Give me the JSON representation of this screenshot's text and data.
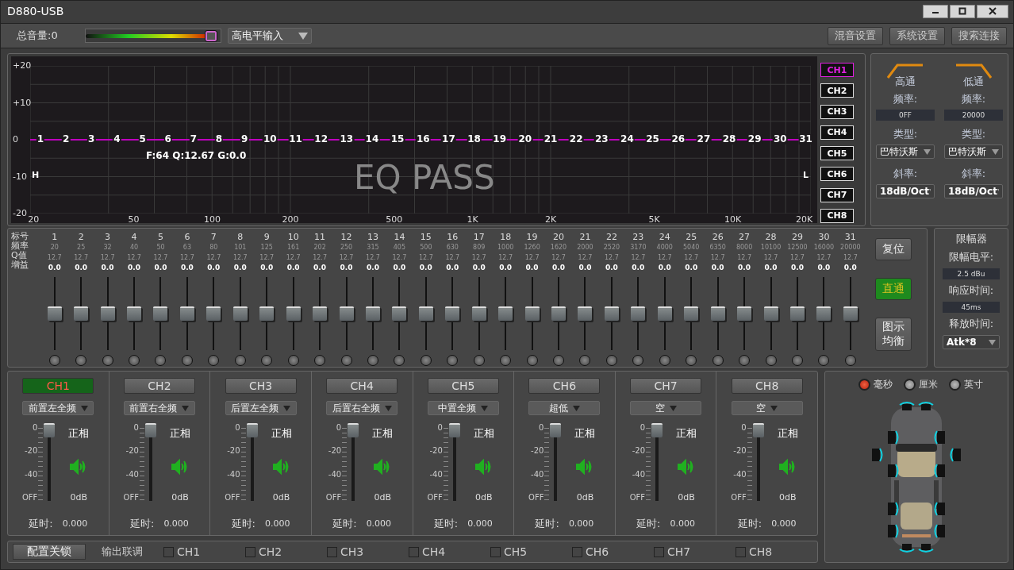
{
  "window": {
    "title": "D880-USB"
  },
  "toolbar": {
    "volume_label": "总音量:0",
    "volume": {
      "level": 1
    },
    "input_select": "高电平输入",
    "buttons": [
      "混音设置",
      "系统设置",
      "搜索连接"
    ]
  },
  "eq_graph": {
    "y_ticks": [
      "+20",
      "+10",
      "0",
      "-10",
      "-20"
    ],
    "x_ticks": [
      "20",
      "50",
      "100",
      "200",
      "500",
      "1K",
      "2K",
      "5K",
      "10K",
      "20K"
    ],
    "band_markers": [
      "1",
      "2",
      "3",
      "4",
      "5",
      "6",
      "7",
      "8",
      "9",
      "10",
      "11",
      "12",
      "13",
      "14",
      "15",
      "16",
      "17",
      "18",
      "19",
      "20",
      "21",
      "22",
      "23",
      "24",
      "25",
      "26",
      "27",
      "28",
      "29",
      "30",
      "31"
    ],
    "readout": "F:64 Q:12.67 G:0.0",
    "status": "EQ PASS",
    "left_mark": "H",
    "right_mark": "L"
  },
  "channel_tabs": [
    {
      "label": "CH1",
      "selected": true
    },
    {
      "label": "CH2",
      "selected": false
    },
    {
      "label": "CH3",
      "selected": false
    },
    {
      "label": "CH4",
      "selected": false
    },
    {
      "label": "CH5",
      "selected": false
    },
    {
      "label": "CH6",
      "selected": false
    },
    {
      "label": "CH7",
      "selected": false
    },
    {
      "label": "CH8",
      "selected": false
    }
  ],
  "filters": [
    {
      "kind": "highpass",
      "title": "高通",
      "freq_label": "频率:",
      "freq": "0FF",
      "type_label": "类型:",
      "type": "巴特沃斯",
      "slope_label": "斜率:",
      "slope": "18dB/Oct"
    },
    {
      "kind": "lowpass",
      "title": "低通",
      "freq_label": "频率:",
      "freq": "20000",
      "type_label": "类型:",
      "type": "巴特沃斯",
      "slope_label": "斜率:",
      "slope": "18dB/Oct"
    }
  ],
  "bands": {
    "row_labels": [
      "标号",
      "频率",
      "Q值",
      "增益"
    ],
    "items": [
      {
        "number": "1",
        "freq": "20",
        "q": "12.7",
        "gain": "0.0",
        "level": 0.5
      },
      {
        "number": "2",
        "freq": "25",
        "q": "12.7",
        "gain": "0.0",
        "level": 0.5
      },
      {
        "number": "3",
        "freq": "32",
        "q": "12.7",
        "gain": "0.0",
        "level": 0.5
      },
      {
        "number": "4",
        "freq": "40",
        "q": "12.7",
        "gain": "0.0",
        "level": 0.5
      },
      {
        "number": "5",
        "freq": "50",
        "q": "12.7",
        "gain": "0.0",
        "level": 0.5
      },
      {
        "number": "6",
        "freq": "63",
        "q": "12.7",
        "gain": "0.0",
        "level": 0.5
      },
      {
        "number": "7",
        "freq": "80",
        "q": "12.7",
        "gain": "0.0",
        "level": 0.5
      },
      {
        "number": "8",
        "freq": "101",
        "q": "12.7",
        "gain": "0.0",
        "level": 0.5
      },
      {
        "number": "9",
        "freq": "125",
        "q": "12.7",
        "gain": "0.0",
        "level": 0.5
      },
      {
        "number": "10",
        "freq": "161",
        "q": "12.7",
        "gain": "0.0",
        "level": 0.5
      },
      {
        "number": "11",
        "freq": "202",
        "q": "12.7",
        "gain": "0.0",
        "level": 0.5
      },
      {
        "number": "12",
        "freq": "250",
        "q": "12.7",
        "gain": "0.0",
        "level": 0.5
      },
      {
        "number": "13",
        "freq": "315",
        "q": "12.7",
        "gain": "0.0",
        "level": 0.5
      },
      {
        "number": "14",
        "freq": "405",
        "q": "12.7",
        "gain": "0.0",
        "level": 0.5
      },
      {
        "number": "15",
        "freq": "500",
        "q": "12.7",
        "gain": "0.0",
        "level": 0.5
      },
      {
        "number": "16",
        "freq": "630",
        "q": "12.7",
        "gain": "0.0",
        "level": 0.5
      },
      {
        "number": "17",
        "freq": "809",
        "q": "12.7",
        "gain": "0.0",
        "level": 0.5
      },
      {
        "number": "18",
        "freq": "1000",
        "q": "12.7",
        "gain": "0.0",
        "level": 0.5
      },
      {
        "number": "19",
        "freq": "1260",
        "q": "12.7",
        "gain": "0.0",
        "level": 0.5
      },
      {
        "number": "20",
        "freq": "1620",
        "q": "12.7",
        "gain": "0.0",
        "level": 0.5
      },
      {
        "number": "21",
        "freq": "2000",
        "q": "12.7",
        "gain": "0.0",
        "level": 0.5
      },
      {
        "number": "22",
        "freq": "2520",
        "q": "12.7",
        "gain": "0.0",
        "level": 0.5
      },
      {
        "number": "23",
        "freq": "3170",
        "q": "12.7",
        "gain": "0.0",
        "level": 0.5
      },
      {
        "number": "24",
        "freq": "4000",
        "q": "12.7",
        "gain": "0.0",
        "level": 0.5
      },
      {
        "number": "25",
        "freq": "5040",
        "q": "12.7",
        "gain": "0.0",
        "level": 0.5
      },
      {
        "number": "26",
        "freq": "6350",
        "q": "12.7",
        "gain": "0.0",
        "level": 0.5
      },
      {
        "number": "27",
        "freq": "8000",
        "q": "12.7",
        "gain": "0.0",
        "level": 0.5
      },
      {
        "number": "28",
        "freq": "10100",
        "q": "12.7",
        "gain": "0.0",
        "level": 0.5
      },
      {
        "number": "29",
        "freq": "12500",
        "q": "12.7",
        "gain": "0.0",
        "level": 0.5
      },
      {
        "number": "30",
        "freq": "16000",
        "q": "12.7",
        "gain": "0.0",
        "level": 0.5
      },
      {
        "number": "31",
        "freq": "20000",
        "q": "12.7",
        "gain": "0.0",
        "level": 0.5
      }
    ]
  },
  "eq_buttons": [
    {
      "label": "复位",
      "active": false
    },
    {
      "label": "直通",
      "active": true
    },
    {
      "label": "图示均衡",
      "active": false
    }
  ],
  "limiter": {
    "title": "限幅器",
    "level_label": "限幅电平:",
    "level_value": "2.5 dBu",
    "attack_label": "响应时间:",
    "attack_value": "45ms",
    "release_label": "释放时间:",
    "release_value": "Atk*8"
  },
  "outputs": [
    {
      "label": "CH1",
      "selected": true,
      "source": "前置左全频",
      "scale": [
        "0",
        "-20",
        "-40",
        "OFF"
      ],
      "level": 1,
      "phase": "正相",
      "gain": "0dB",
      "delay_label": "延时:",
      "delay": "0.000"
    },
    {
      "label": "CH2",
      "selected": false,
      "source": "前置右全频",
      "scale": [
        "0",
        "-20",
        "-40",
        "OFF"
      ],
      "level": 1,
      "phase": "正相",
      "gain": "0dB",
      "delay_label": "延时:",
      "delay": "0.000"
    },
    {
      "label": "CH3",
      "selected": false,
      "source": "后置左全频",
      "scale": [
        "0",
        "-20",
        "-40",
        "OFF"
      ],
      "level": 1,
      "phase": "正相",
      "gain": "0dB",
      "delay_label": "延时:",
      "delay": "0.000"
    },
    {
      "label": "CH4",
      "selected": false,
      "source": "后置右全频",
      "scale": [
        "0",
        "-20",
        "-40",
        "OFF"
      ],
      "level": 1,
      "phase": "正相",
      "gain": "0dB",
      "delay_label": "延时:",
      "delay": "0.000"
    },
    {
      "label": "CH5",
      "selected": false,
      "source": "中置全频",
      "scale": [
        "0",
        "-20",
        "-40",
        "OFF"
      ],
      "level": 1,
      "phase": "正相",
      "gain": "0dB",
      "delay_label": "延时:",
      "delay": "0.000"
    },
    {
      "label": "CH6",
      "selected": false,
      "source": "超低",
      "scale": [
        "0",
        "-20",
        "-40",
        "OFF"
      ],
      "level": 1,
      "phase": "正相",
      "gain": "0dB",
      "delay_label": "延时:",
      "delay": "0.000"
    },
    {
      "label": "CH7",
      "selected": false,
      "source": "空",
      "scale": [
        "0",
        "-20",
        "-40",
        "OFF"
      ],
      "level": 1,
      "phase": "正相",
      "gain": "0dB",
      "delay_label": "延时:",
      "delay": "0.000"
    },
    {
      "label": "CH8",
      "selected": false,
      "source": "空",
      "scale": [
        "0",
        "-20",
        "-40",
        "OFF"
      ],
      "level": 1,
      "phase": "正相",
      "gain": "0dB",
      "delay_label": "延时:",
      "delay": "0.000"
    }
  ],
  "bottom_bar": {
    "lock_button": "配置关锁",
    "link_label": "输出联调",
    "link_channels": [
      {
        "label": "CH1",
        "checked": false
      },
      {
        "label": "CH2",
        "checked": false
      },
      {
        "label": "CH3",
        "checked": false
      },
      {
        "label": "CH4",
        "checked": false
      },
      {
        "label": "CH5",
        "checked": false
      },
      {
        "label": "CH6",
        "checked": false
      },
      {
        "label": "CH7",
        "checked": false
      },
      {
        "label": "CH8",
        "checked": false
      }
    ]
  },
  "units": [
    {
      "label": "毫秒",
      "selected": true
    },
    {
      "label": "厘米",
      "selected": false
    },
    {
      "label": "英寸",
      "selected": false
    }
  ]
}
